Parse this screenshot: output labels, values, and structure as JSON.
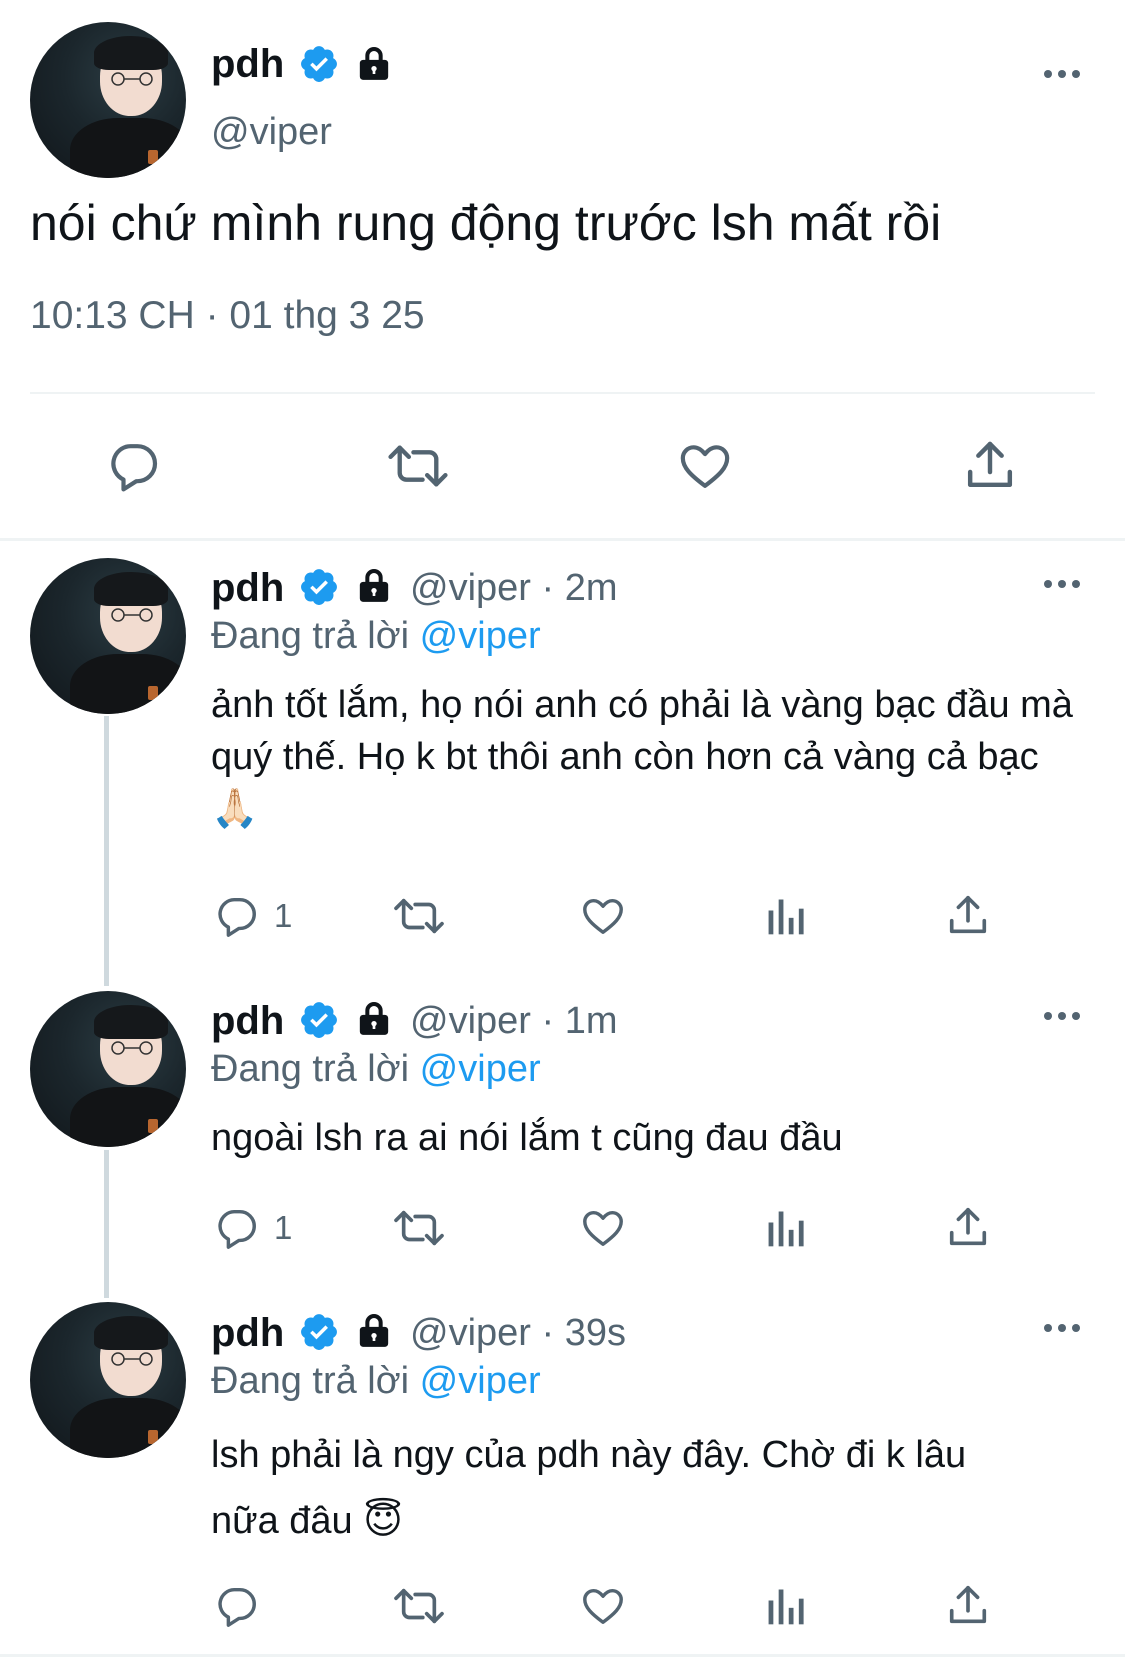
{
  "main_tweet": {
    "display_name": "pdh",
    "handle": "@viper",
    "text": "nói chứ mình rung động trước lsh mất rồi",
    "timestamp": "10:13 CH · 01 thg 3 25",
    "icons": [
      "more-icon",
      "reply-icon",
      "retweet-icon",
      "like-icon",
      "share-icon"
    ]
  },
  "replies": [
    {
      "display_name": "pdh",
      "meta": "@viper · 2m",
      "replying_label": "Đang trả lời",
      "replying_to": "@viper",
      "text": "ảnh tốt lắm, họ nói anh có phải là vàng bạc đầu mà quý thế. Họ k bt thôi anh còn hơn cả vàng cả bạc 🙏🏻",
      "reply_count": "1"
    },
    {
      "display_name": "pdh",
      "meta": "@viper · 1m",
      "replying_label": "Đang trả lời",
      "replying_to": "@viper",
      "text": "ngoài lsh ra ai nói lắm t cũng đau đầu",
      "reply_count": "1"
    },
    {
      "display_name": "pdh",
      "meta": "@viper · 39s",
      "replying_label": "Đang trả lời",
      "replying_to": "@viper",
      "text": "lsh phải là ngy của pdh này đây. Chờ đi k lâu nữa đâu 😇",
      "reply_count": ""
    }
  ],
  "colors": {
    "accent": "#1d9bf0",
    "secondary_text": "#536471",
    "divider": "#eff3f4"
  }
}
